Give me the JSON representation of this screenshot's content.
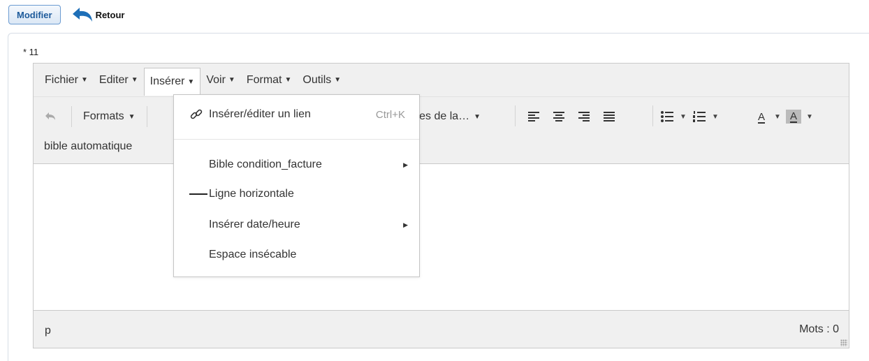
{
  "topbar": {
    "modifier_label": "Modifier",
    "retour_label": "Retour"
  },
  "field": {
    "label": "* 11"
  },
  "menubar": {
    "items": [
      {
        "label": "Fichier"
      },
      {
        "label": "Editer"
      },
      {
        "label": "Insérer"
      },
      {
        "label": "Voir"
      },
      {
        "label": "Format"
      },
      {
        "label": "Outils"
      }
    ]
  },
  "toolbar": {
    "formats_label": "Formats",
    "styles_label": "lles de la…",
    "bible_label": "bible automatique",
    "text_color_label": "A",
    "bg_color_label": "A"
  },
  "dropdown": {
    "link": {
      "label": "Insérer/éditer un lien",
      "shortcut": "Ctrl+K"
    },
    "bible": {
      "label": "Bible condition_facture"
    },
    "hr": {
      "label": "Ligne horizontale"
    },
    "date": {
      "label": "Insérer date/heure"
    },
    "nbsp": {
      "label": "Espace insécable"
    }
  },
  "statusbar": {
    "path": "p",
    "words": "Mots : 0"
  },
  "colors": {
    "accent": "#1d5a9b",
    "retour_icon": "#1e6fb8",
    "toolbar_bg": "#f0f0f0"
  },
  "icons": [
    "undo-arrow-icon",
    "undo-icon",
    "link-icon",
    "horizontal-line-icon",
    "align-left-icon",
    "align-center-icon",
    "align-right-icon",
    "align-justify-icon",
    "bullet-list-icon",
    "numbered-list-icon",
    "chevron-right-icon",
    "resize-grip-icon"
  ]
}
